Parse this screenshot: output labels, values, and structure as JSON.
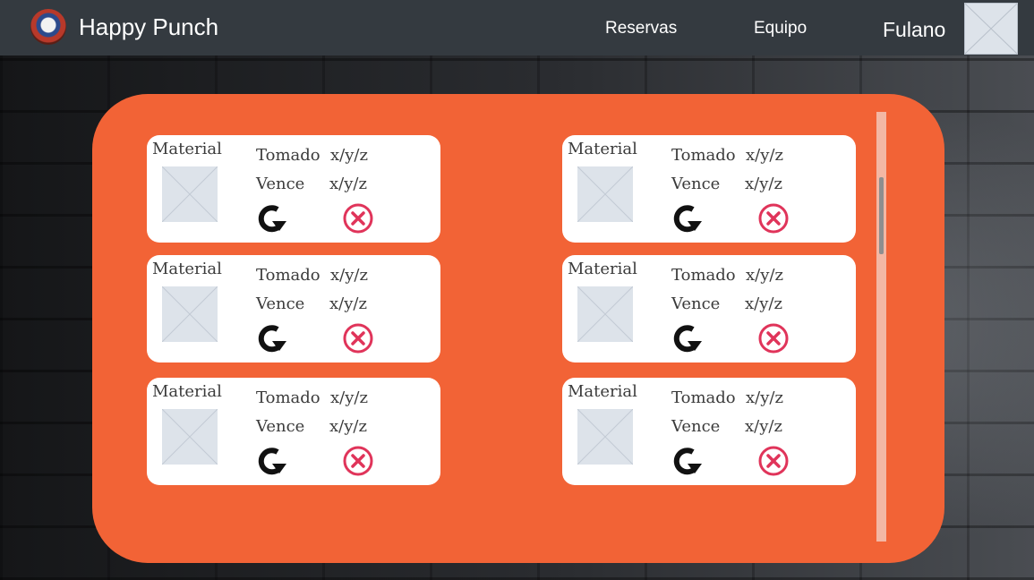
{
  "navbar": {
    "brand_name": "Happy Punch",
    "links": [
      "Reservas",
      "Equipo"
    ],
    "user_name": "Fulano"
  },
  "loans": [
    {
      "material_label": "Material",
      "taken_label": "Tomado",
      "taken_value": "x/y/z",
      "due_label": "Vence",
      "due_value": "x/y/z"
    },
    {
      "material_label": "Material",
      "taken_label": "Tomado",
      "taken_value": "x/y/z",
      "due_label": "Vence",
      "due_value": "x/y/z"
    },
    {
      "material_label": "Material",
      "taken_label": "Tomado",
      "taken_value": "x/y/z",
      "due_label": "Vence",
      "due_value": "x/y/z"
    },
    {
      "material_label": "Material",
      "taken_label": "Tomado",
      "taken_value": "x/y/z",
      "due_label": "Vence",
      "due_value": "x/y/z"
    },
    {
      "material_label": "Material",
      "taken_label": "Tomado",
      "taken_value": "x/y/z",
      "due_label": "Vence",
      "due_value": "x/y/z"
    },
    {
      "material_label": "Material",
      "taken_label": "Tomado",
      "taken_value": "x/y/z",
      "due_label": "Vence",
      "due_value": "x/y/z"
    }
  ],
  "icons": {
    "renew": "renew-arrow-icon",
    "cancel": "cancel-circle-x-icon",
    "placeholder": "image-placeholder-icon"
  },
  "colors": {
    "navbar": "#343a40",
    "panel": "#f26336",
    "card": "#ffffff",
    "cancel_icon": "#e0345a",
    "renew_icon": "#111111"
  }
}
